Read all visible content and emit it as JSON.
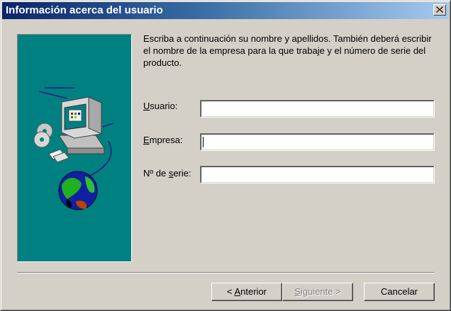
{
  "window": {
    "title": "Información acerca del usuario"
  },
  "intro_text": "Escriba a continuación su nombre y apellidos. También deberá escribir el nombre de la empresa para la que trabaje y el número de serie del producto.",
  "fields": [
    {
      "label_prefix": "",
      "label_accel": "U",
      "label_rest": "suario:",
      "value": ""
    },
    {
      "label_prefix": "",
      "label_accel": "E",
      "label_rest": "mpresa:",
      "value": ""
    },
    {
      "label_prefix": "Nº de ",
      "label_accel": "s",
      "label_rest": "erie:",
      "value": ""
    }
  ],
  "buttons": {
    "back": {
      "lt": "< ",
      "accel": "A",
      "rest": "nterior"
    },
    "next": {
      "accel": "S",
      "rest": "iguiente >"
    },
    "cancel": "Cancelar"
  },
  "colors": {
    "panel": "#008080",
    "title_start": "#0a246a",
    "title_end": "#a6caf0"
  },
  "icons": [
    "close-icon",
    "computer-illustration"
  ]
}
